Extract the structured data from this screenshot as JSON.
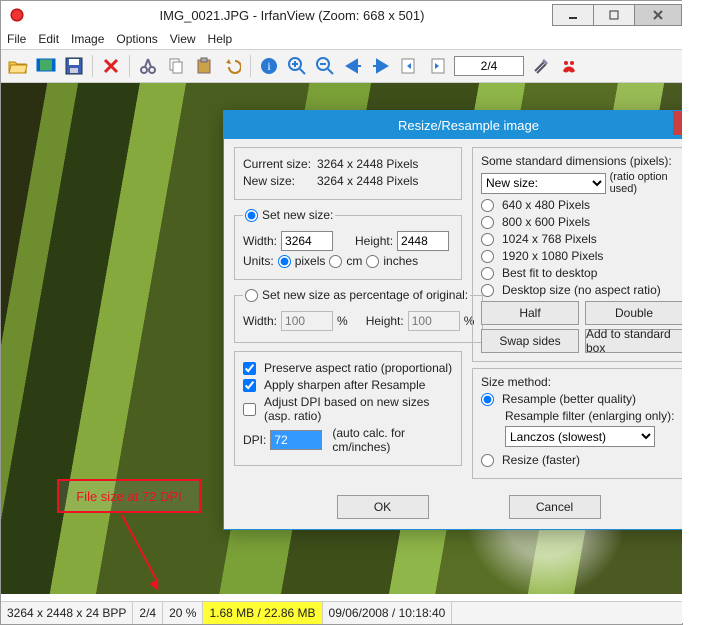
{
  "titlebar": {
    "text": "IMG_0021.JPG - IrfanView (Zoom: 668 x 501)"
  },
  "menus": [
    "File",
    "Edit",
    "Image",
    "Options",
    "View",
    "Help"
  ],
  "nav_value": "2/4",
  "annotation": "File size at 72 DPI",
  "status": {
    "dims": "3264 x 2448 x 24 BPP",
    "index": "2/4",
    "zoom": "20 %",
    "size": "1.68 MB / 22.86 MB",
    "date": "09/06/2008 / 10:18:40"
  },
  "dialog": {
    "title": "Resize/Resample image",
    "current_label": "Current size:",
    "current_value": "3264  x  2448  Pixels",
    "new_label": "New size:",
    "new_value": "3264  x  2448  Pixels",
    "set_new_size": "Set new size:",
    "width_label": "Width:",
    "width_value": "3264",
    "height_label": "Height:",
    "height_value": "2448",
    "units_label": "Units:",
    "unit_pixels": "pixels",
    "unit_cm": "cm",
    "unit_inches": "inches",
    "set_percent": "Set new size as percentage of original:",
    "pct_width": "100",
    "pct_height": "100",
    "preserve": "Preserve aspect ratio (proportional)",
    "sharpen": "Apply sharpen after Resample",
    "adjust_dpi": "Adjust DPI based on new sizes (asp. ratio)",
    "dpi_label": "DPI:",
    "dpi_value": "72",
    "dpi_hint": "(auto calc. for cm/inches)",
    "ok": "OK",
    "cancel": "Cancel",
    "std_label": "Some standard dimensions (pixels):",
    "std_select": "New size:",
    "std_hint": "(ratio option used)",
    "std": [
      "640 x 480 Pixels",
      "800 x 600 Pixels",
      "1024 x 768 Pixels",
      "1920 x 1080 Pixels",
      "Best fit to desktop",
      "Desktop size (no aspect ratio)"
    ],
    "half": "Half",
    "double": "Double",
    "swap": "Swap sides",
    "addstd": "Add to standard box",
    "method_label": "Size method:",
    "resample": "Resample (better quality)",
    "filter_label": "Resample filter (enlarging only):",
    "filter_value": "Lanczos (slowest)",
    "resize": "Resize (faster)"
  }
}
